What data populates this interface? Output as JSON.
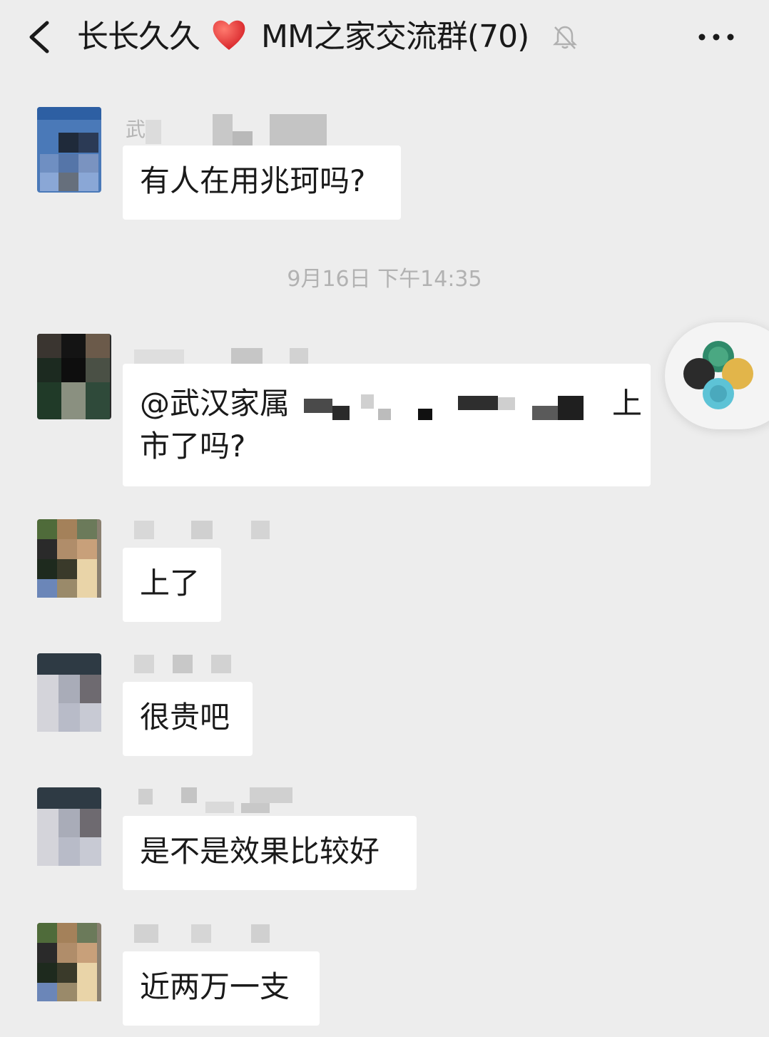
{
  "header": {
    "title_name": "长长久久",
    "title_rest": "MM之家交流群(70)",
    "back_icon": "chevron-left-icon",
    "mute_icon": "bell-off-icon",
    "more_icon": "more-horizontal-icon"
  },
  "messages": [
    {
      "sender_partial": "武",
      "text": "有人在用兆珂吗?"
    },
    {
      "text_line1_prefix": "@武汉家属",
      "text_line1_suffix": "上",
      "text_line2": "市了吗?"
    },
    {
      "text": "上了"
    },
    {
      "text": "很贵吧"
    },
    {
      "text": "是不是效果比较好"
    },
    {
      "text": "近两万一支"
    }
  ],
  "timestamp": "9月16日 下午14:35",
  "colors": {
    "background": "#ededed",
    "bubble": "#ffffff",
    "timestamp": "#b2b2b2"
  }
}
